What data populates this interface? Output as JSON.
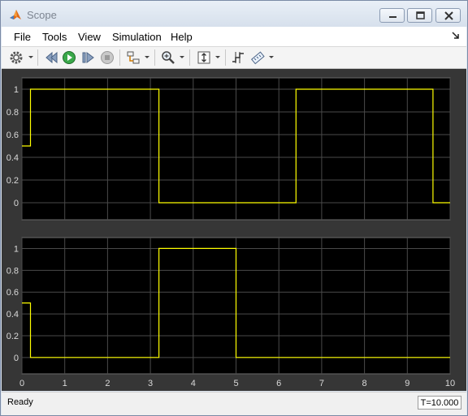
{
  "window": {
    "title": "Scope"
  },
  "menu": [
    "File",
    "Tools",
    "View",
    "Simulation",
    "Help"
  ],
  "toolbar": {
    "icons": [
      "gear-icon",
      "step-back-icon",
      "run-icon",
      "step-forward-icon",
      "stop-icon",
      "block-highlight-icon",
      "zoom-icon",
      "autoscale-icon",
      "cursor-measurements-icon",
      "signal-statistics-icon"
    ]
  },
  "colors": {
    "plot_background": "#000000",
    "figure_background": "#363636",
    "grid": "#4a4a4a",
    "axis_text": "#d9d9d9",
    "signal": "#ffff00"
  },
  "chart_data": [
    {
      "type": "line",
      "step": true,
      "ylim": [
        -0.15,
        1.1
      ],
      "yticks": [
        0,
        0.2,
        0.4,
        0.6,
        0.8,
        1
      ],
      "ytick_labels": [
        "0",
        "0.2",
        "0.4",
        "0.6",
        "0.8",
        "1"
      ],
      "xlim": [
        0,
        10
      ],
      "grid": true,
      "series": [
        {
          "x": [
            0,
            0.2,
            0.2,
            3.2,
            3.2,
            6.4,
            6.4,
            9.6,
            9.6,
            10
          ],
          "y": [
            0.5,
            0.5,
            1,
            1,
            0,
            0,
            1,
            1,
            0,
            0
          ]
        }
      ]
    },
    {
      "type": "line",
      "step": true,
      "ylim": [
        -0.15,
        1.1
      ],
      "yticks": [
        0,
        0.2,
        0.4,
        0.6,
        0.8,
        1
      ],
      "ytick_labels": [
        "0",
        "0.2",
        "0.4",
        "0.6",
        "0.8",
        "1"
      ],
      "xlim": [
        0,
        10
      ],
      "xticks": [
        0,
        1,
        2,
        3,
        4,
        5,
        6,
        7,
        8,
        9,
        10
      ],
      "xtick_labels": [
        "0",
        "1",
        "2",
        "3",
        "4",
        "5",
        "6",
        "7",
        "8",
        "9",
        "10"
      ],
      "grid": true,
      "series": [
        {
          "x": [
            0,
            0.2,
            0.2,
            3.2,
            3.2,
            5,
            5,
            10
          ],
          "y": [
            0.5,
            0.5,
            0,
            0,
            1,
            1,
            0,
            0
          ]
        }
      ]
    }
  ],
  "status": {
    "text": "Ready",
    "time": "T=10.000"
  }
}
